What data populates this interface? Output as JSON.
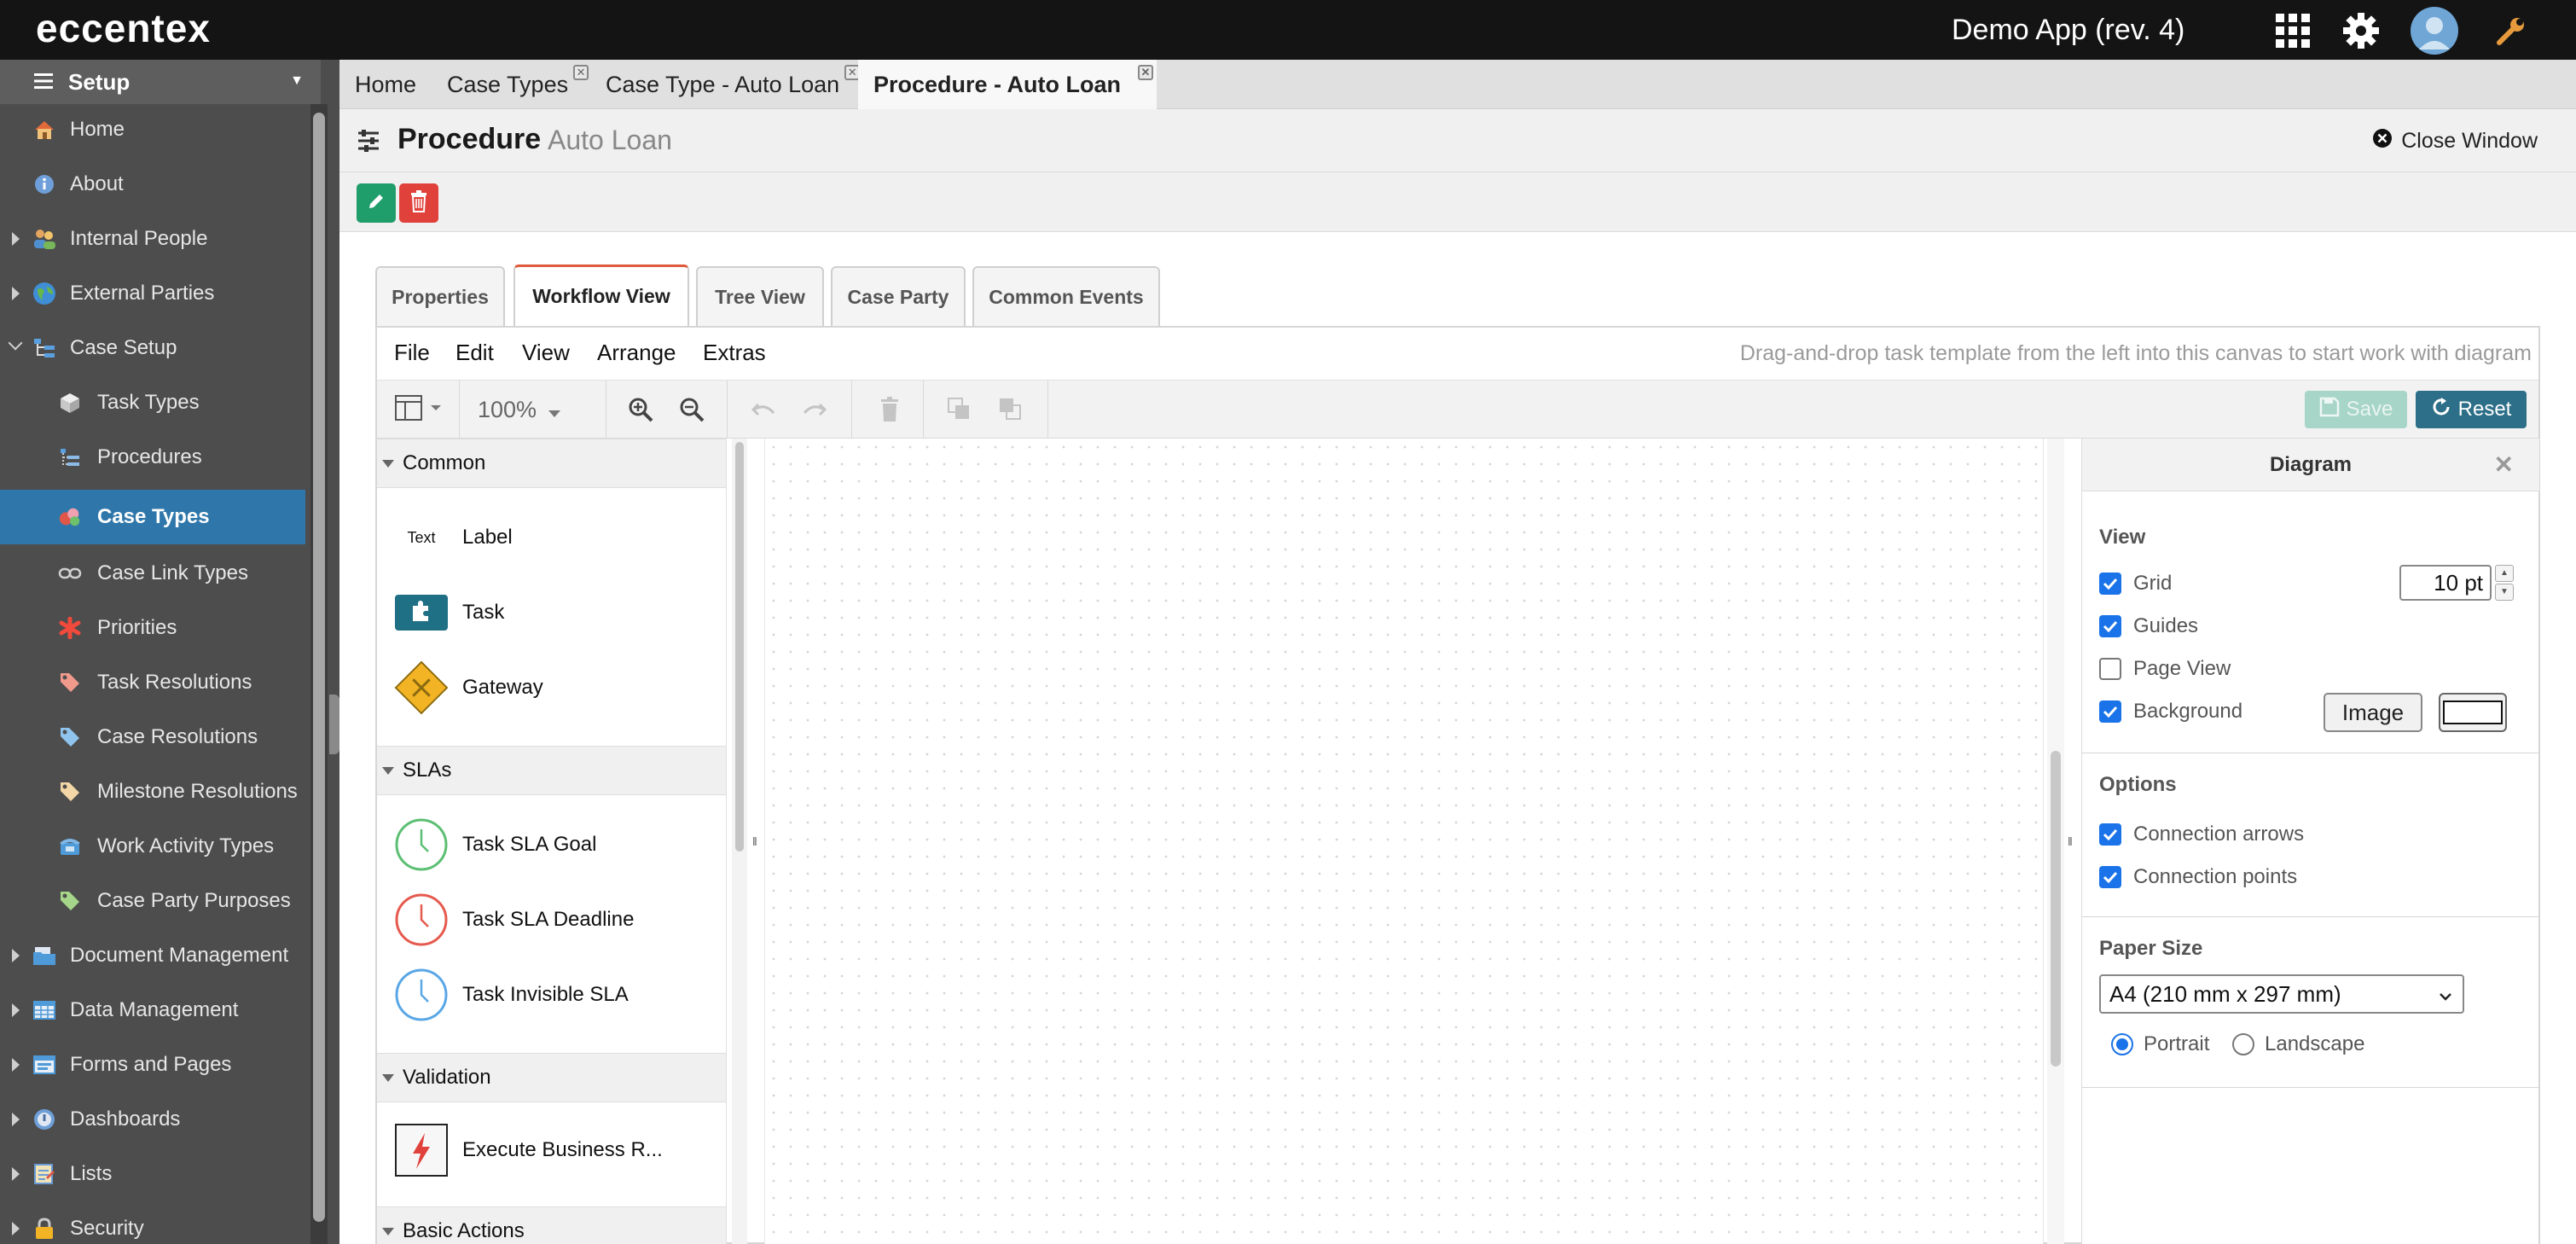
{
  "app": {
    "logo": "eccentex",
    "name": "Demo App (rev. 4)",
    "icons": [
      "apps-grid-icon",
      "gear-icon",
      "avatar",
      "wrench-icon"
    ]
  },
  "sidebar": {
    "setup_label": "Setup",
    "items": [
      {
        "label": "Home",
        "icon": "home-icon",
        "level": 0
      },
      {
        "label": "About",
        "icon": "info-icon",
        "level": 0
      },
      {
        "label": "Internal People",
        "icon": "people-icon",
        "level": 0,
        "expandable": true
      },
      {
        "label": "External Parties",
        "icon": "globe-icon",
        "level": 0,
        "expandable": true
      },
      {
        "label": "Case Setup",
        "icon": "hierarchy-icon",
        "level": 0,
        "expanded": true
      },
      {
        "label": "Task Types",
        "icon": "cube-icon",
        "level": 1
      },
      {
        "label": "Procedures",
        "icon": "procedure-icon",
        "level": 1
      },
      {
        "label": "Case Types",
        "icon": "case-types-icon",
        "level": 1,
        "active": true
      },
      {
        "label": "Case Link Types",
        "icon": "link-icon",
        "level": 1
      },
      {
        "label": "Priorities",
        "icon": "asterisk-icon",
        "level": 1
      },
      {
        "label": "Task Resolutions",
        "icon": "tag-icon",
        "level": 1
      },
      {
        "label": "Case Resolutions",
        "icon": "tag-icon",
        "level": 1
      },
      {
        "label": "Milestone Resolutions",
        "icon": "tag-icon",
        "level": 1
      },
      {
        "label": "Work Activity Types",
        "icon": "phone-icon",
        "level": 1
      },
      {
        "label": "Case Party Purposes",
        "icon": "tag-icon",
        "level": 1
      },
      {
        "label": "Document Management",
        "icon": "folder-icon",
        "level": 0,
        "expandable": true
      },
      {
        "label": "Data Management",
        "icon": "table-icon",
        "level": 0,
        "expandable": true
      },
      {
        "label": "Forms and Pages",
        "icon": "form-icon",
        "level": 0,
        "expandable": true
      },
      {
        "label": "Dashboards",
        "icon": "dashboard-icon",
        "level": 0,
        "expandable": true
      },
      {
        "label": "Lists",
        "icon": "list-icon",
        "level": 0,
        "expandable": true
      },
      {
        "label": "Security",
        "icon": "lock-icon",
        "level": 0,
        "expandable": true
      }
    ]
  },
  "tabs": [
    {
      "label": "Home",
      "closable": false,
      "active": false
    },
    {
      "label": "Case Types",
      "closable": true,
      "active": false
    },
    {
      "label": "Case Type - Auto Loan",
      "closable": true,
      "active": false
    },
    {
      "label": "Procedure - Auto Loan",
      "closable": true,
      "active": true
    }
  ],
  "procedure": {
    "title": "Procedure",
    "subtitle": "Auto Loan",
    "close_window": "Close Window"
  },
  "view_tabs": [
    {
      "label": "Properties",
      "active": false
    },
    {
      "label": "Workflow View",
      "active": true
    },
    {
      "label": "Tree View",
      "active": false
    },
    {
      "label": "Case Party",
      "active": false
    },
    {
      "label": "Common Events",
      "active": false
    }
  ],
  "editor": {
    "menu": [
      "File",
      "Edit",
      "View",
      "Arrange",
      "Extras"
    ],
    "hint": "Drag-and-drop task template from the left into this canvas to start work with diagram",
    "zoom": "100%",
    "save_label": "Save",
    "reset_label": "Reset"
  },
  "palette": {
    "common_label": "Common",
    "label_icon_text": "Text",
    "label_item": "Label",
    "task_item": "Task",
    "gateway_item": "Gateway",
    "slas_label": "SLAs",
    "sla_goal": "Task SLA Goal",
    "sla_deadline": "Task SLA Deadline",
    "sla_invisible": "Task Invisible SLA",
    "validation_label": "Validation",
    "execute_rule": "Execute Business R...",
    "basic_actions_label": "Basic Actions"
  },
  "format_panel": {
    "title": "Diagram",
    "view_label": "View",
    "grid_label": "Grid",
    "grid_checked": true,
    "grid_size": "10 pt",
    "guides_label": "Guides",
    "guides_checked": true,
    "page_view_label": "Page View",
    "page_view_checked": false,
    "background_label": "Background",
    "background_checked": true,
    "image_button": "Image",
    "background_color": "#ffffff",
    "options_label": "Options",
    "connection_arrows_label": "Connection arrows",
    "connection_arrows_checked": true,
    "connection_points_label": "Connection points",
    "connection_points_checked": true,
    "paper_size_label": "Paper Size",
    "paper_size_value": "A4 (210 mm x 297 mm)",
    "portrait_label": "Portrait",
    "portrait_selected": true,
    "landscape_label": "Landscape"
  },
  "colors": {
    "topbar": "#141414",
    "sidebar": "#4d4d4d",
    "active_item": "#2f77aa",
    "edit_button": "#1f9d6a",
    "delete_button": "#e0413a",
    "active_tab_accent": "#e05a3c",
    "task_icon": "#1f6f85",
    "gateway": "#f2b324",
    "sla_goal": "#5cbf73",
    "sla_deadline": "#e55a4e",
    "sla_invisible": "#5aa7e6",
    "checkbox": "#1a73e8"
  }
}
